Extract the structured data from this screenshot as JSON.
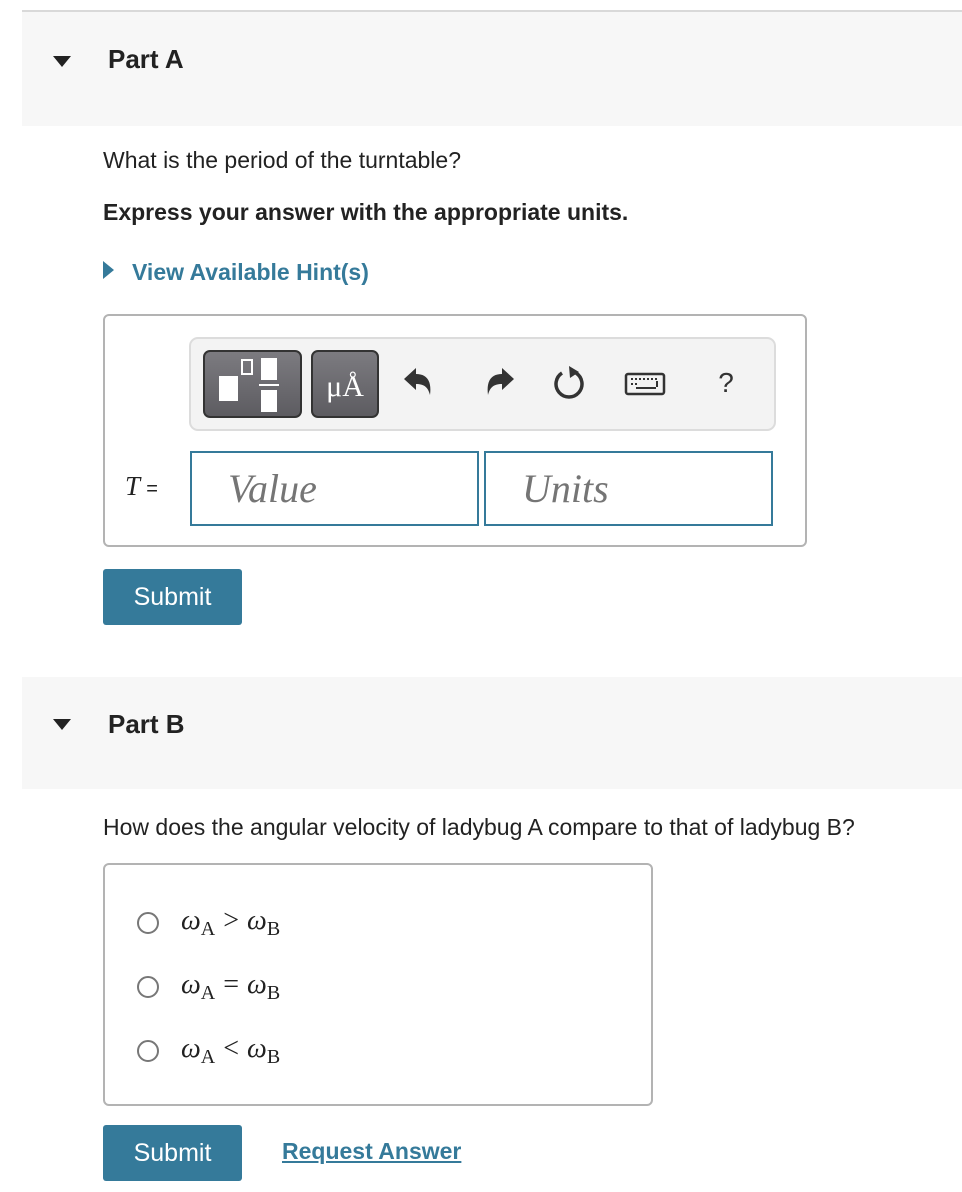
{
  "partA": {
    "title": "Part A",
    "question": "What is the period of the turntable?",
    "instruction": "Express your answer with the appropriate units.",
    "hint_link": "View Available Hint(s)",
    "toolbar": {
      "icons": [
        "templates-icon",
        "units-symbol-icon",
        "undo-icon",
        "redo-icon",
        "reset-icon",
        "keyboard-icon",
        "help-icon"
      ],
      "units_label": "μÅ",
      "help_label": "?"
    },
    "variable": "T",
    "equals": "=",
    "value_placeholder": "Value",
    "units_placeholder": "Units",
    "submit_label": "Submit"
  },
  "partB": {
    "title": "Part B",
    "question": "How does the angular velocity of ladybug A compare to that of ladybug B?",
    "choices": [
      {
        "lhs": "ω",
        "lhs_sub": "A",
        "op": ">",
        "rhs": "ω",
        "rhs_sub": "B",
        "selected": false
      },
      {
        "lhs": "ω",
        "lhs_sub": "A",
        "op": "=",
        "rhs": "ω",
        "rhs_sub": "B",
        "selected": false
      },
      {
        "lhs": "ω",
        "lhs_sub": "A",
        "op": "<",
        "rhs": "ω",
        "rhs_sub": "B",
        "selected": false
      }
    ],
    "submit_label": "Submit",
    "request_answer_label": "Request Answer"
  },
  "colors": {
    "accent": "#357a9a",
    "header_bg": "#f7f7f7",
    "border": "#b3b3b3"
  }
}
